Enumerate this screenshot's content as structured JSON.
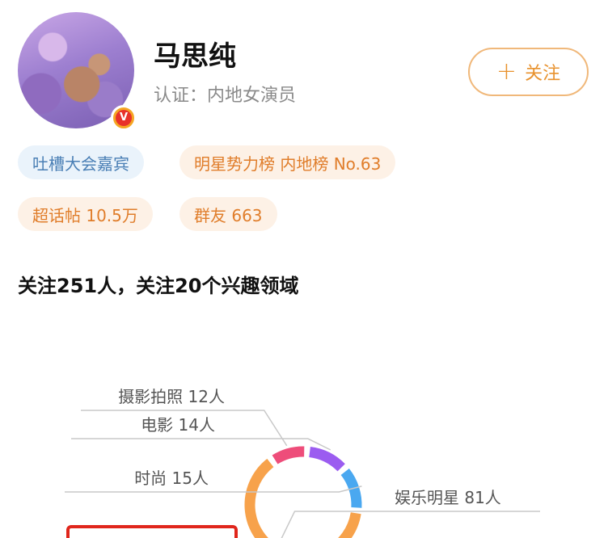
{
  "profile": {
    "name": "马思纯",
    "certification": "认证：内地女演员",
    "follow_button": {
      "icon": "plus-icon",
      "label": "关注"
    },
    "verified_badge": "V"
  },
  "tags": [
    {
      "label": "吐槽大会嘉宾",
      "style": "blue"
    },
    {
      "label": "明星势力榜 内地榜 No.63",
      "style": "orange"
    },
    {
      "label": "超话帖 10.5万",
      "style": "orange"
    },
    {
      "label": "群友 663",
      "style": "orange"
    }
  ],
  "follow_summary": "关注251人，关注20个兴趣领域",
  "colors": {
    "accent_orange": "#e8922e",
    "tag_blue_bg": "#eaf3fb",
    "tag_orange_bg": "#fdf1e6",
    "highlight_red": "#e0261c"
  },
  "chart_data": {
    "type": "pie",
    "style": "donut",
    "slices": [
      {
        "label": "摄影拍照 12人",
        "name": "摄影拍照",
        "value": 12,
        "color": "#ee4d7a"
      },
      {
        "label": "电影 14人",
        "name": "电影",
        "value": 14,
        "color": "#9b5cf0"
      },
      {
        "label": "时尚 15人",
        "name": "时尚",
        "value": 15,
        "color": "#4aa8f0"
      },
      {
        "label": "娱乐明星 81人",
        "name": "娱乐明星",
        "value": 81,
        "color": "#f7a24b"
      }
    ]
  }
}
